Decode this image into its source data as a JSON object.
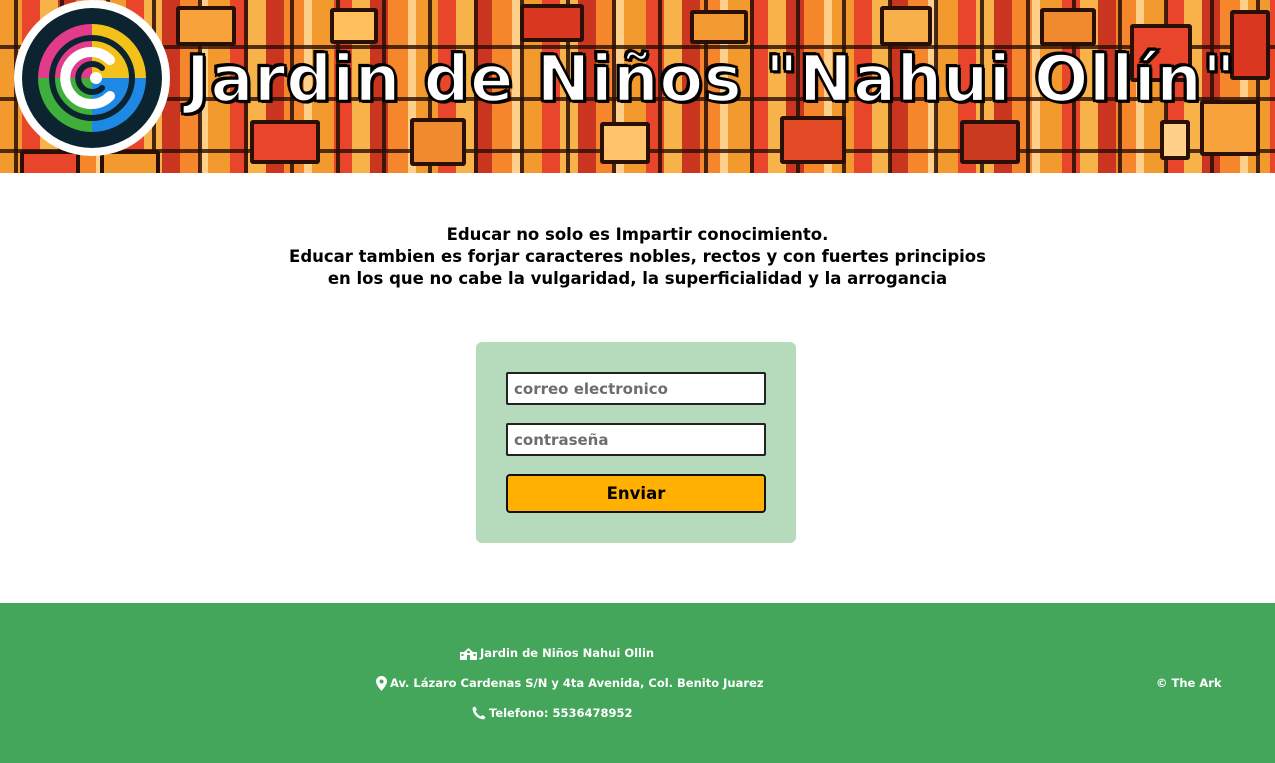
{
  "header": {
    "title": "Jardin de Niños \"Nahui Ollín\"",
    "logo_icon": "spiral-logo-icon"
  },
  "quote": {
    "line1": "Educar no solo es Impartir conocimiento.",
    "line2": "Educar tambien es forjar caracteres nobles, rectos y con fuertes principios",
    "line3": "en los que no cabe la vulgaridad, la superficialidad y la arrogancia"
  },
  "login": {
    "email_placeholder": "correo electronico",
    "password_placeholder": "contraseña",
    "submit_label": "Enviar",
    "submit_color": "#ffb000",
    "card_color": "#b5dbbc"
  },
  "footer": {
    "school_name": "Jardin de Niños Nahui Ollin",
    "school_icon": "school-icon",
    "address": "Av. Lázaro Cardenas S/N y 4ta Avenida, Col. Benito Juarez",
    "address_icon": "map-pin-icon",
    "phone": "Telefono: 5536478952",
    "phone_icon": "phone-icon",
    "copyright": "© The Ark",
    "background_color": "#44a65a"
  }
}
